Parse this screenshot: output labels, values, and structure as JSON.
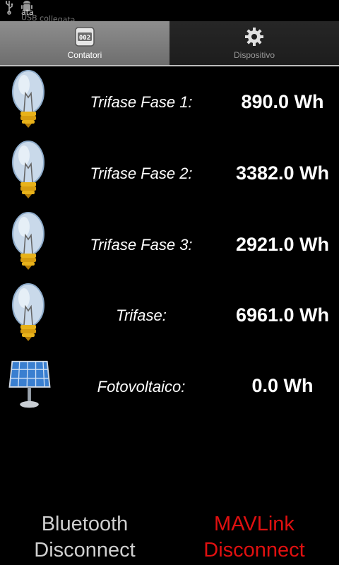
{
  "status": {
    "notification_title": "ata",
    "notification_sub": "USB collegata"
  },
  "tabs": [
    {
      "label": "Contatori",
      "icon": "counter-icon",
      "selected": true
    },
    {
      "label": "Dispositivo",
      "icon": "gear-icon",
      "selected": false
    }
  ],
  "counters": [
    {
      "icon": "light-bulb-icon",
      "label": "Trifase Fase 1:",
      "value": "890.0 Wh"
    },
    {
      "icon": "light-bulb-icon",
      "label": "Trifase Fase 2:",
      "value": "3382.0 Wh"
    },
    {
      "icon": "light-bulb-icon",
      "label": "Trifase Fase 3:",
      "value": "2921.0 Wh"
    },
    {
      "icon": "light-bulb-icon",
      "label": "Trifase:",
      "value": "6961.0 Wh"
    },
    {
      "icon": "solar-panel-icon",
      "label": "Fotovoltaico:",
      "value": "0.0 Wh"
    }
  ],
  "buttons": {
    "bluetooth_line1": "Bluetooth",
    "bluetooth_line2": "Disconnect",
    "mavlink_line1": "MAVLink",
    "mavlink_line2": "Disconnect"
  },
  "colors": {
    "mavlink_text": "#e01010",
    "bluetooth_text": "#cfcfcf"
  }
}
